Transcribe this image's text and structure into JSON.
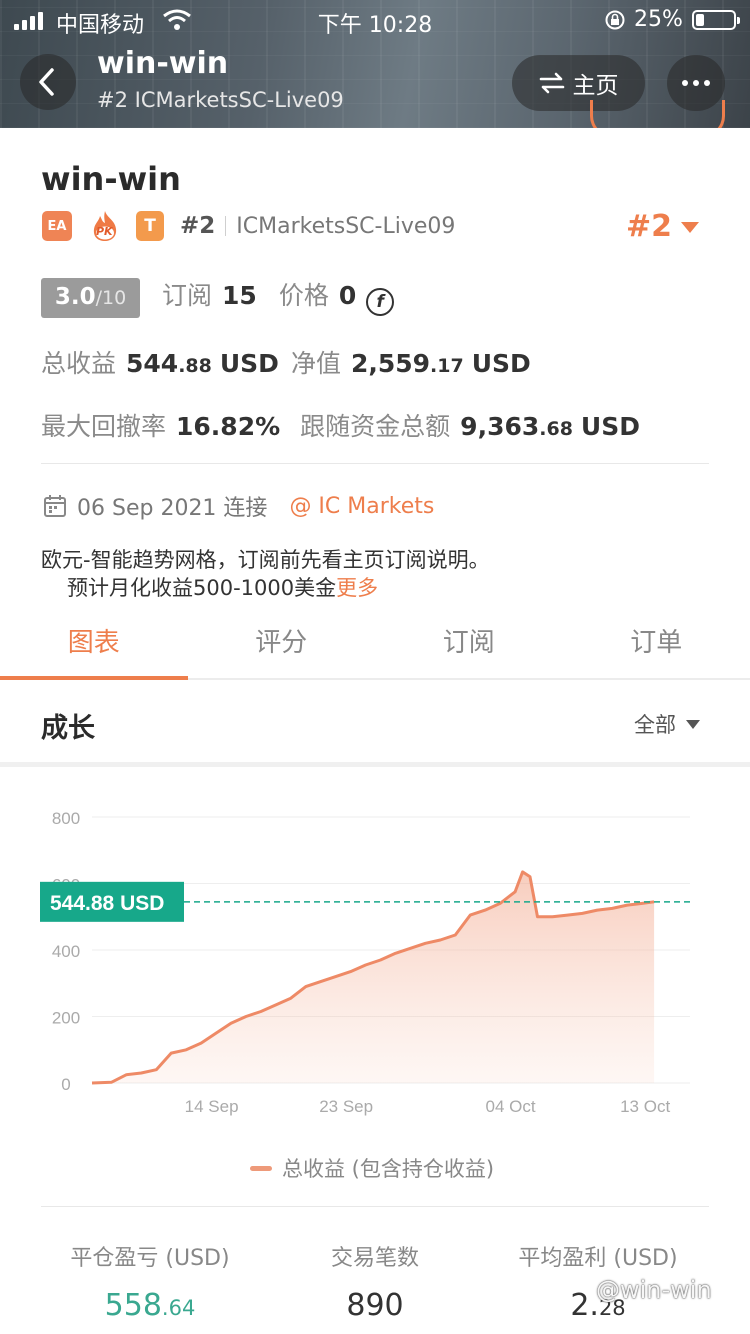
{
  "status_bar": {
    "carrier": "中国移动",
    "time": "下午 10:28",
    "battery": "25%"
  },
  "nav": {
    "title": "win-win",
    "subtitle": "#2 ICMarketsSC-Live09",
    "home_label": "主页"
  },
  "profile": {
    "name": "win-win",
    "badge_ea": "EA",
    "badge_pk": "PK",
    "badge_t": "T",
    "rank": "#2",
    "server": "ICMarketsSC-Live09",
    "rank_big": "#2",
    "score": "3.0",
    "score_max": "/10",
    "subscribe_label": "订阅",
    "subscribe_value": "15",
    "price_label": "价格",
    "price_value": "0",
    "coin_symbol": "f",
    "total_profit_label": "总收益",
    "total_profit_int": "544",
    "total_profit_dec": ".88",
    "total_profit_unit": "USD",
    "equity_label": "净值",
    "equity_int": "2,559",
    "equity_dec": ".17",
    "equity_unit": "USD",
    "drawdown_label": "最大回撤率",
    "drawdown_value": "16.82%",
    "follow_label": "跟随资金总额",
    "follow_int": "9,363",
    "follow_dec": ".68",
    "follow_unit": "USD",
    "connect_date": "06 Sep 2021 连接",
    "broker": "@ IC Markets",
    "description_line1": "欧元-智能趋势网格，订阅前先看主页订阅说明。",
    "description_line2": "预计月化收益500-1000美金",
    "more_link": "更多"
  },
  "tabs": [
    "图表",
    "评分",
    "订阅",
    "订单"
  ],
  "section": {
    "title": "成长",
    "range": "全部"
  },
  "chart_data": {
    "type": "area",
    "current_label": "544.88 USD",
    "current_value": 544.88,
    "yticks": [
      "0",
      "200",
      "400",
      "600",
      "800"
    ],
    "ylim": [
      0,
      800
    ],
    "xticks": [
      {
        "label": "14 Sep",
        "x": 8
      },
      {
        "label": "23 Sep",
        "x": 17
      },
      {
        "label": "04 Oct",
        "x": 28
      },
      {
        "label": "13 Oct",
        "x": 37
      }
    ],
    "xlim": [
      0,
      40
    ],
    "legend": "总收益 (包含持仓收益)",
    "series": [
      {
        "name": "总收益 (包含持仓收益)",
        "color": "#ee8a66",
        "points": [
          [
            0,
            0
          ],
          [
            1.3,
            2
          ],
          [
            2.3,
            25
          ],
          [
            3.3,
            30
          ],
          [
            4.3,
            40
          ],
          [
            5.3,
            90
          ],
          [
            6.3,
            100
          ],
          [
            7.3,
            120
          ],
          [
            8.3,
            150
          ],
          [
            9.3,
            180
          ],
          [
            10.3,
            200
          ],
          [
            11.3,
            215
          ],
          [
            12.3,
            235
          ],
          [
            13.3,
            255
          ],
          [
            14.3,
            290
          ],
          [
            15.3,
            305
          ],
          [
            16.3,
            320
          ],
          [
            17.3,
            335
          ],
          [
            18.3,
            355
          ],
          [
            19.3,
            370
          ],
          [
            20.3,
            390
          ],
          [
            21.3,
            405
          ],
          [
            22.3,
            420
          ],
          [
            23.3,
            430
          ],
          [
            24.3,
            445
          ],
          [
            25.3,
            505
          ],
          [
            26.3,
            520
          ],
          [
            27.3,
            540
          ],
          [
            28.3,
            575
          ],
          [
            28.8,
            635
          ],
          [
            29.3,
            620
          ],
          [
            29.8,
            500
          ],
          [
            30.8,
            500
          ],
          [
            31.8,
            505
          ],
          [
            32.8,
            510
          ],
          [
            33.8,
            520
          ],
          [
            34.8,
            525
          ],
          [
            35.8,
            535
          ],
          [
            36.8,
            540
          ],
          [
            37.6,
            544.88
          ]
        ]
      }
    ]
  },
  "stats": [
    {
      "label": "平仓盈亏 (USD)",
      "int": "558",
      "dec": ".64",
      "color": "#3aa890"
    },
    {
      "label": "交易笔数",
      "int": "890",
      "dec": "",
      "color": "#333333"
    },
    {
      "label": "平均盈利 (USD)",
      "int": "2.",
      "dec": "28",
      "color": "#333333"
    }
  ],
  "watermark": "@win-win",
  "colors": {
    "accent": "#ee7e4c",
    "positive": "#3aa890",
    "value_tag": "#17a88a"
  }
}
